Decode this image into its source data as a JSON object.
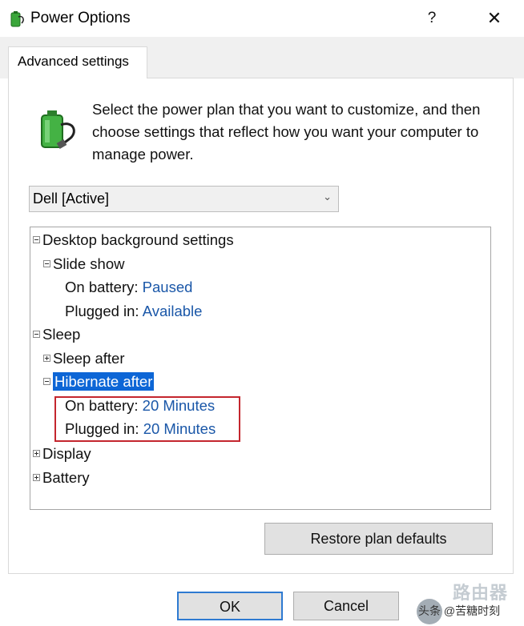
{
  "window": {
    "title": "Power Options",
    "help_label": "?",
    "close_label": "✕"
  },
  "tab": {
    "label": "Advanced settings"
  },
  "description": "Select the power plan that you want to customize, and then choose settings that reflect how you want your computer to manage power.",
  "plan_select": {
    "value": "Dell [Active]",
    "chevron": "⌄"
  },
  "tree": {
    "desktop_background": "Desktop background settings",
    "slide_show": "Slide show",
    "slide_on_battery_label": "On battery:",
    "slide_on_battery_value": "Paused",
    "slide_plugged_label": "Plugged in:",
    "slide_plugged_value": "Available",
    "sleep": "Sleep",
    "sleep_after": "Sleep after",
    "hibernate_after": "Hibernate after",
    "hib_on_battery_label": "On battery:",
    "hib_on_battery_value": "20 Minutes",
    "hib_plugged_label": "Plugged in:",
    "hib_plugged_value": "20 Minutes",
    "display": "Display",
    "battery": "Battery"
  },
  "buttons": {
    "restore": "Restore plan defaults",
    "ok": "OK",
    "cancel": "Cancel"
  },
  "watermark": {
    "brand": "路由器",
    "handle": "头条 @苦糖时刻"
  },
  "colors": {
    "selection": "#0d66d6",
    "value_text": "#1a57a8",
    "highlight_box": "#c4262e"
  }
}
